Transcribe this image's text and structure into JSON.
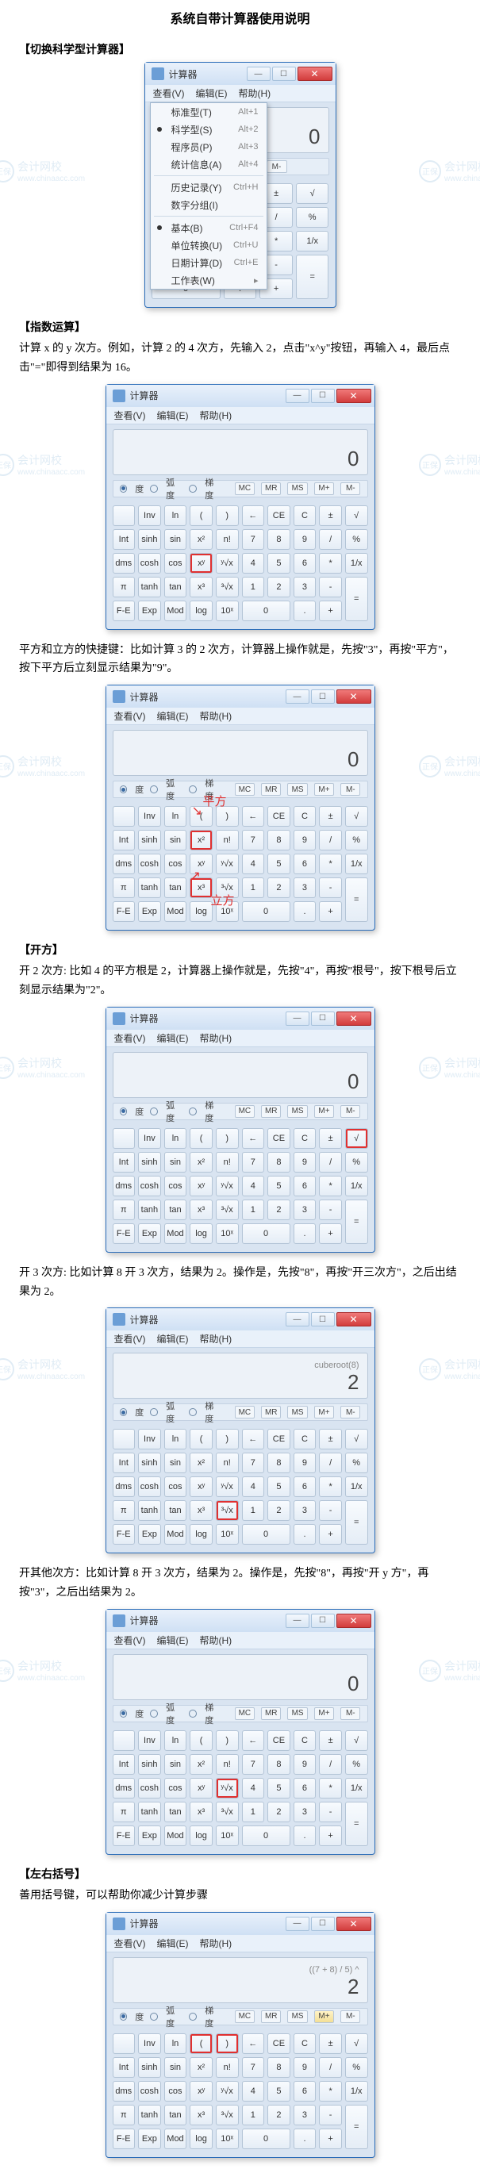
{
  "doc_title": "系统自带计算器使用说明",
  "sections": {
    "s1_title": "【切换科学型计算器】",
    "s2_title": "【指数运算】",
    "s2_text": "计算 x 的 y 次方。例如，计算 2 的 4 次方，先输入 2，点击\"x^y\"按钮，再输入 4，最后点击\"=\"即得到结果为 16。",
    "s2_text2": "平方和立方的快捷键：比如计算 3 的 2 次方，计算器上操作就是，先按\"3\"，再按\"平方\"，按下平方后立刻显示结果为\"9\"。",
    "s3_title": "【开方】",
    "s3_text": "开 2 次方: 比如 4 的平方根是 2，计算器上操作就是，先按\"4\"，再按\"根号\"，按下根号后立刻显示结果为\"2\"。",
    "s3_text2": "开 3 次方: 比如计算 8 开 3 次方，结果为 2。操作是，先按\"8\"，再按\"开三次方\"，之后出结果为 2。",
    "s3_text3": "开其他次方：比如计算 8 开 3 次方，结果为 2。操作是，先按\"8\"，再按\"开 y 方\"，再按\"3\"，之后出结果为 2。",
    "s4_title": "【左右括号】",
    "s4_text": "善用括号键，可以帮助你减少计算步骤"
  },
  "calc": {
    "window_title": "计算器",
    "menu": {
      "view": "查看(V)",
      "edit": "编辑(E)",
      "help": "帮助(H)"
    },
    "dropdown": [
      {
        "label": "标准型(T)",
        "sc": "Alt+1"
      },
      {
        "label": "科学型(S)",
        "sc": "Alt+2",
        "on": true
      },
      {
        "label": "程序员(P)",
        "sc": "Alt+3"
      },
      {
        "label": "统计信息(A)",
        "sc": "Alt+4"
      },
      {
        "sep": true
      },
      {
        "label": "历史记录(Y)",
        "sc": "Ctrl+H"
      },
      {
        "label": "数字分组(I)",
        "sc": ""
      },
      {
        "sep": true
      },
      {
        "label": "基本(B)",
        "sc": "Ctrl+F4",
        "on": true
      },
      {
        "label": "单位转换(U)",
        "sc": "Ctrl+U"
      },
      {
        "label": "日期计算(D)",
        "sc": "Ctrl+E"
      },
      {
        "label": "工作表(W)",
        "sc": "",
        "arrow": true
      }
    ],
    "radio": {
      "deg": "度",
      "rad": "弧度",
      "grad": "梯度"
    },
    "mem_labels": [
      "MC",
      "MR",
      "MS",
      "M+",
      "M-"
    ],
    "sci_rows": [
      [
        "",
        "Inv",
        "ln",
        "(",
        ")",
        "←",
        "CE",
        "C",
        "±",
        "√"
      ],
      [
        "Int",
        "sinh",
        "sin",
        "x²",
        "n!",
        "7",
        "8",
        "9",
        "/",
        "%"
      ],
      [
        "dms",
        "cosh",
        "cos",
        "xʸ",
        "ʸ√x",
        "4",
        "5",
        "6",
        "*",
        "1/x"
      ],
      [
        "π",
        "tanh",
        "tan",
        "x³",
        "³√x",
        "1",
        "2",
        "3",
        "-",
        "="
      ],
      [
        "F-E",
        "Exp",
        "Mod",
        "log",
        "10ˣ",
        "0",
        "",
        ".",
        "+",
        ""
      ]
    ],
    "std_keypad": {
      "r1": [
        "←",
        "CE",
        "C",
        "±",
        "√"
      ],
      "r2": [
        "7",
        "8",
        "9",
        "/",
        "%"
      ],
      "r3": [
        "4",
        "5",
        "6",
        "*",
        "1/x"
      ],
      "r4": [
        "1",
        "2",
        "3",
        "-",
        "="
      ],
      "r5": [
        "0",
        "",
        ".",
        "+",
        ""
      ]
    },
    "displays": {
      "zero": "0",
      "cuberoot_sub": "cuberoot(8)",
      "cuberoot_main": "2",
      "paren_sub": "((7 + 8) / 5) ^",
      "paren_main": "2"
    },
    "annot": {
      "square": "平方",
      "cube": "立方"
    },
    "watermark": {
      "brand": "正保",
      "brand2": "会计网校",
      "url": "www.chinaacc.com"
    }
  }
}
